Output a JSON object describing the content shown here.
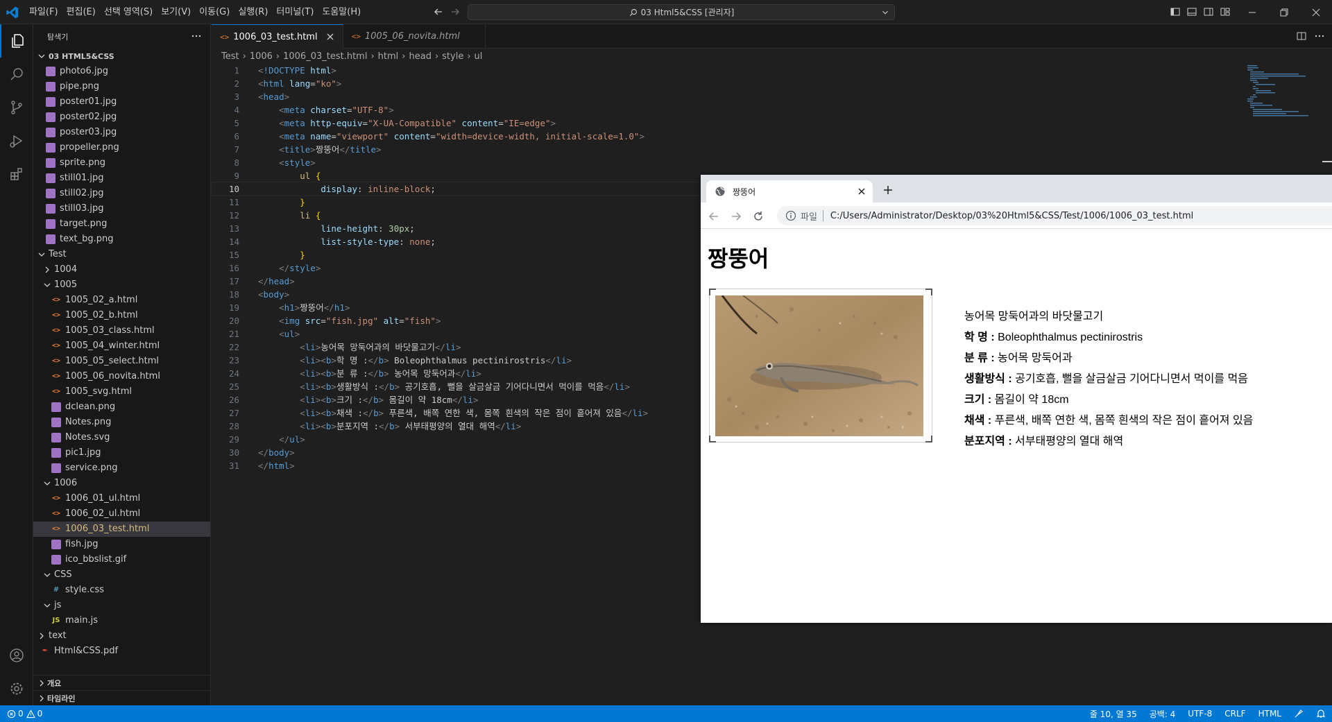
{
  "menu": [
    "파일(F)",
    "편집(E)",
    "선택 영역(S)",
    "보기(V)",
    "이동(G)",
    "실행(R)",
    "터미널(T)",
    "도움말(H)"
  ],
  "command_center": "03 Html5&CSS [관리자]",
  "sidebar": {
    "title": "탐색기",
    "root": "03 HTML5&CSS",
    "items": [
      {
        "label": "photo6.jpg",
        "type": "img",
        "depth": 1
      },
      {
        "label": "pipe.png",
        "type": "img",
        "depth": 1
      },
      {
        "label": "poster01.jpg",
        "type": "img",
        "depth": 1
      },
      {
        "label": "poster02.jpg",
        "type": "img",
        "depth": 1
      },
      {
        "label": "poster03.jpg",
        "type": "img",
        "depth": 1
      },
      {
        "label": "propeller.png",
        "type": "img",
        "depth": 1
      },
      {
        "label": "sprite.png",
        "type": "img",
        "depth": 1
      },
      {
        "label": "still01.jpg",
        "type": "img",
        "depth": 1
      },
      {
        "label": "still02.jpg",
        "type": "img",
        "depth": 1
      },
      {
        "label": "still03.jpg",
        "type": "img",
        "depth": 1
      },
      {
        "label": "target.png",
        "type": "img",
        "depth": 1
      },
      {
        "label": "text_bg.png",
        "type": "img",
        "depth": 1
      },
      {
        "label": "Test",
        "type": "folder-open",
        "depth": 0
      },
      {
        "label": "1004",
        "type": "folder",
        "depth": 1
      },
      {
        "label": "1005",
        "type": "folder-open",
        "depth": 1
      },
      {
        "label": "1005_02_a.html",
        "type": "html",
        "depth": 2
      },
      {
        "label": "1005_02_b.html",
        "type": "html",
        "depth": 2
      },
      {
        "label": "1005_03_class.html",
        "type": "html",
        "depth": 2
      },
      {
        "label": "1005_04_winter.html",
        "type": "html",
        "depth": 2
      },
      {
        "label": "1005_05_select.html",
        "type": "html",
        "depth": 2
      },
      {
        "label": "1005_06_novita.html",
        "type": "html",
        "depth": 2
      },
      {
        "label": "1005_svg.html",
        "type": "html",
        "depth": 2
      },
      {
        "label": "dclean.png",
        "type": "img",
        "depth": 2
      },
      {
        "label": "Notes.png",
        "type": "img",
        "depth": 2
      },
      {
        "label": "Notes.svg",
        "type": "img",
        "depth": 2
      },
      {
        "label": "pic1.jpg",
        "type": "img",
        "depth": 2
      },
      {
        "label": "service.png",
        "type": "img",
        "depth": 2
      },
      {
        "label": "1006",
        "type": "folder-open",
        "depth": 1
      },
      {
        "label": "1006_01_ul.html",
        "type": "html",
        "depth": 2
      },
      {
        "label": "1006_02_ul.html",
        "type": "html",
        "depth": 2
      },
      {
        "label": "1006_03_test.html",
        "type": "html",
        "depth": 2,
        "selected": true
      },
      {
        "label": "fish.jpg",
        "type": "img",
        "depth": 2
      },
      {
        "label": "ico_bbslist.gif",
        "type": "img",
        "depth": 2
      },
      {
        "label": "CSS",
        "type": "folder-open",
        "depth": 1
      },
      {
        "label": "style.css",
        "type": "css",
        "depth": 2
      },
      {
        "label": "js",
        "type": "folder-open",
        "depth": 1
      },
      {
        "label": "main.js",
        "type": "js",
        "depth": 2
      },
      {
        "label": "text",
        "type": "folder",
        "depth": 0
      },
      {
        "label": "Html&CSS.pdf",
        "type": "pdf",
        "depth": 0
      }
    ],
    "bottom_panels": [
      "개요",
      "타임라인"
    ]
  },
  "tabs": [
    {
      "label": "1006_03_test.html",
      "active": true
    },
    {
      "label": "1005_06_novita.html",
      "active": false
    }
  ],
  "breadcrumb": [
    "Test",
    "1006",
    "1006_03_test.html",
    "html",
    "head",
    "style",
    "ul"
  ],
  "code_lines": [
    "<!DOCTYPE html>",
    "<html lang=\"ko\">",
    "<head>",
    "    <meta charset=\"UTF-8\">",
    "    <meta http-equiv=\"X-UA-Compatible\" content=\"IE=edge\">",
    "    <meta name=\"viewport\" content=\"width=device-width, initial-scale=1.0\">",
    "    <title>짱뚱어</title>",
    "    <style>",
    "        ul {",
    "            display: inline-block;",
    "        }",
    "        li {",
    "            line-height: 30px;",
    "            list-style-type: none;",
    "        }",
    "    </style>",
    "</head>",
    "<body>",
    "    <h1>짱뚱어</h1>",
    "    <img src=\"fish.jpg\" alt=\"fish\">",
    "    <ul>",
    "        <li>농어목 망둑어과의 바닷물고기</li>",
    "        <li><b>학 명 :</b> Boleophthalmus pectinirostris</li>",
    "        <li><b>분 류 :</b> 농어목 망둑어과</li>",
    "        <li><b>생활방식 :</b> 공기호흡, 뻘을 살금살금 기어다니면서 먹이를 먹음</li>",
    "        <li><b>크기 :</b> 몸길이 약 18cm</li>",
    "        <li><b>채색 :</b> 푸른색, 배쪽 연한 색, 몸쪽 흰색의 작은 점이 흩어져 있음</li>",
    "        <li><b>분포지역 :</b> 서부태평양의 열대 해역</li>",
    "    </ul>",
    "</body>",
    "</html>"
  ],
  "current_line": 10,
  "browser": {
    "tab_title": "짱뚱어",
    "scheme_label": "파일",
    "url": "C:/Users/Administrator/Desktop/03%20Html5&CSS/Test/1006/1006_03_test.html",
    "h1": "짱뚱어",
    "img_alt": "fish",
    "list": [
      {
        "bold": "",
        "text": "농어목 망둑어과의 바닷물고기"
      },
      {
        "bold": "학 명 :",
        "text": " Boleophthalmus pectinirostris"
      },
      {
        "bold": "분 류 :",
        "text": " 농어목 망둑어과"
      },
      {
        "bold": "생활방식 :",
        "text": " 공기호흡, 뻘을 살금살금 기어다니면서 먹이를 먹음"
      },
      {
        "bold": "크기 :",
        "text": " 몸길이 약 18cm"
      },
      {
        "bold": "채색 :",
        "text": " 푸른색, 배쪽 연한 색, 몸쪽 흰색의 작은 점이 흩어져 있음"
      },
      {
        "bold": "분포지역 :",
        "text": " 서부태평양의 열대 해역"
      }
    ]
  },
  "status": {
    "errors": "0",
    "warnings": "0",
    "position": "줄 10, 열 35",
    "spaces": "공백: 4",
    "encoding": "UTF-8",
    "eol": "CRLF",
    "language": "HTML"
  },
  "colors": {
    "accent": "#0078d4",
    "status_bar": "#0078d4",
    "editor_bg": "#1f1f1f"
  }
}
